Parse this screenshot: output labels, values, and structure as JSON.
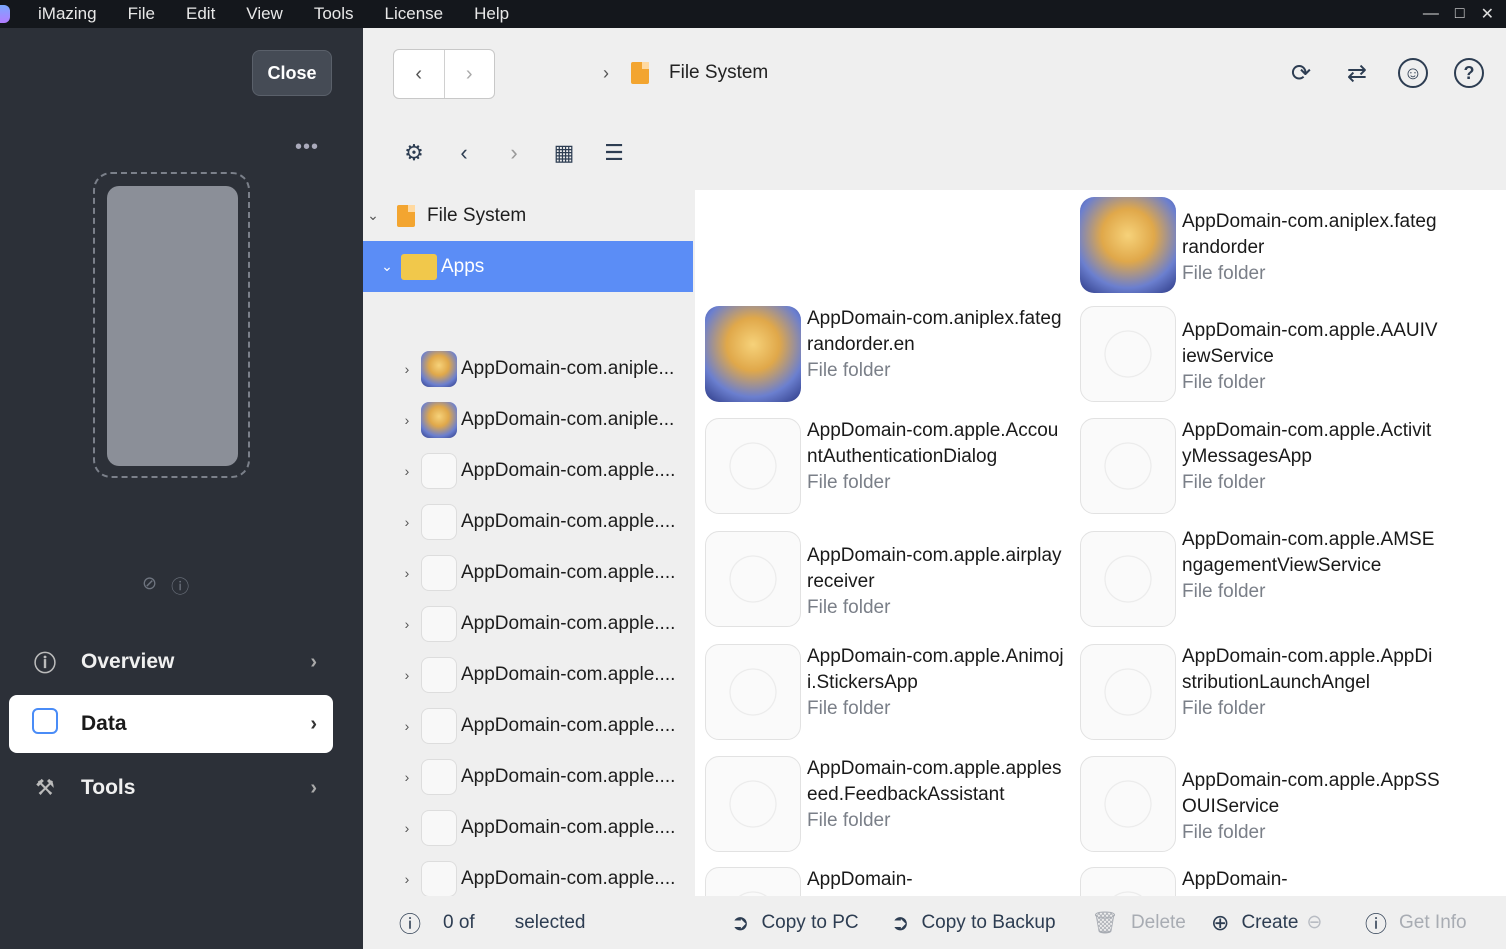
{
  "menubar": {
    "app": "iMazing",
    "items": [
      "File",
      "Edit",
      "View",
      "Tools",
      "License",
      "Help"
    ]
  },
  "sidebar": {
    "close_label": "Close",
    "more_label": "•••",
    "nav": [
      {
        "label": "Overview",
        "icon": "info-icon"
      },
      {
        "label": "Data",
        "icon": "data-icon",
        "active": true
      },
      {
        "label": "Tools",
        "icon": "tools-icon"
      }
    ]
  },
  "header": {
    "breadcrumb": "File System"
  },
  "tree": {
    "root": "File System",
    "selected": "Apps",
    "items": [
      "AppDomain-com.aniple...",
      "AppDomain-com.aniple...",
      "AppDomain-com.apple....",
      "AppDomain-com.apple....",
      "AppDomain-com.apple....",
      "AppDomain-com.apple....",
      "AppDomain-com.apple....",
      "AppDomain-com.apple....",
      "AppDomain-com.apple....",
      "AppDomain-com.apple....",
      "AppDomain-com.apple...."
    ]
  },
  "grid": {
    "items": [
      {
        "name": "AppDomain-com.aniplex.fategrandorder",
        "type": "File folder",
        "icon": "fgo"
      },
      {
        "name": "AppDomain-com.aniplex.fategrandorder.en",
        "type": "File folder",
        "icon": "fgo"
      },
      {
        "name": "AppDomain-com.apple.AAUIViewService",
        "type": "File folder",
        "icon": "blank"
      },
      {
        "name": "AppDomain-com.apple.AccountAuthenticationDialog",
        "type": "File folder",
        "icon": "blank"
      },
      {
        "name": "AppDomain-com.apple.ActivityMessagesApp",
        "type": "File folder",
        "icon": "blank"
      },
      {
        "name": "AppDomain-com.apple.airplayreceiver",
        "type": "File folder",
        "icon": "blank"
      },
      {
        "name": "AppDomain-com.apple.AMSEngagementViewService",
        "type": "File folder",
        "icon": "blank"
      },
      {
        "name": "AppDomain-com.apple.Animoji.StickersApp",
        "type": "File folder",
        "icon": "blank"
      },
      {
        "name": "AppDomain-com.apple.AppDistributionLaunchAngel",
        "type": "File folder",
        "icon": "blank"
      },
      {
        "name": "AppDomain-com.apple.appleseed.FeedbackAssistant",
        "type": "File folder",
        "icon": "blank"
      },
      {
        "name": "AppDomain-com.apple.AppSSOUIService",
        "type": "File folder",
        "icon": "blank"
      },
      {
        "name": "AppDomain-",
        "type": "",
        "icon": "blank"
      },
      {
        "name": "AppDomain-",
        "type": "",
        "icon": "blank"
      }
    ]
  },
  "bottombar": {
    "selection_count": "0 of",
    "selection_label": "selected",
    "copy_to_pc": "Copy to PC",
    "copy_to_backup": "Copy to Backup",
    "delete": "Delete",
    "create": "Create",
    "get_info": "Get Info"
  },
  "colors": {
    "selection": "#5b8df6",
    "sidebar_bg": "#2c3038",
    "accent_blue": "#4a8cf7",
    "folder_orange": "#f3a530"
  }
}
